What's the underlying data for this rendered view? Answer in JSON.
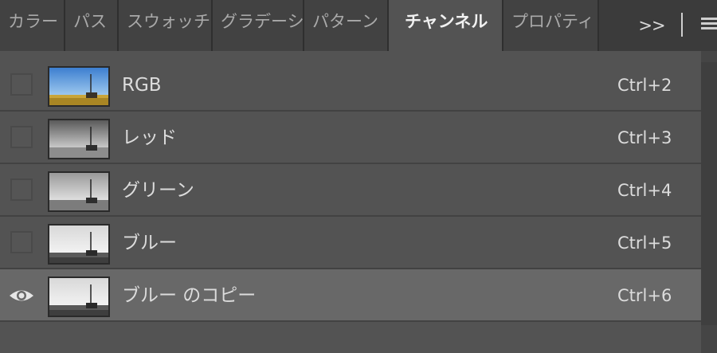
{
  "tabs": [
    {
      "label": "カラー"
    },
    {
      "label": "パス"
    },
    {
      "label": "スウォッチ"
    },
    {
      "label": "グラデーシ"
    },
    {
      "label": "パターン"
    },
    {
      "label": "チャンネル",
      "active": true
    },
    {
      "label": "プロパティ"
    }
  ],
  "tab_overflow_label": ">>",
  "channels": [
    {
      "name": "RGB",
      "shortcut": "Ctrl+2",
      "visible": false,
      "thumb": "color"
    },
    {
      "name": "レッド",
      "shortcut": "Ctrl+3",
      "visible": false,
      "thumb": "gray-dark"
    },
    {
      "name": "グリーン",
      "shortcut": "Ctrl+4",
      "visible": false,
      "thumb": "gray-mid"
    },
    {
      "name": "ブルー",
      "shortcut": "Ctrl+5",
      "visible": false,
      "thumb": "gray-light"
    },
    {
      "name": "ブルー のコピー",
      "shortcut": "Ctrl+6",
      "visible": true,
      "selected": true,
      "thumb": "gray-light"
    }
  ],
  "colors": {
    "panel_bg": "#535353",
    "selected_row": "#686868",
    "tabbar_bg": "#3b3b3b"
  }
}
